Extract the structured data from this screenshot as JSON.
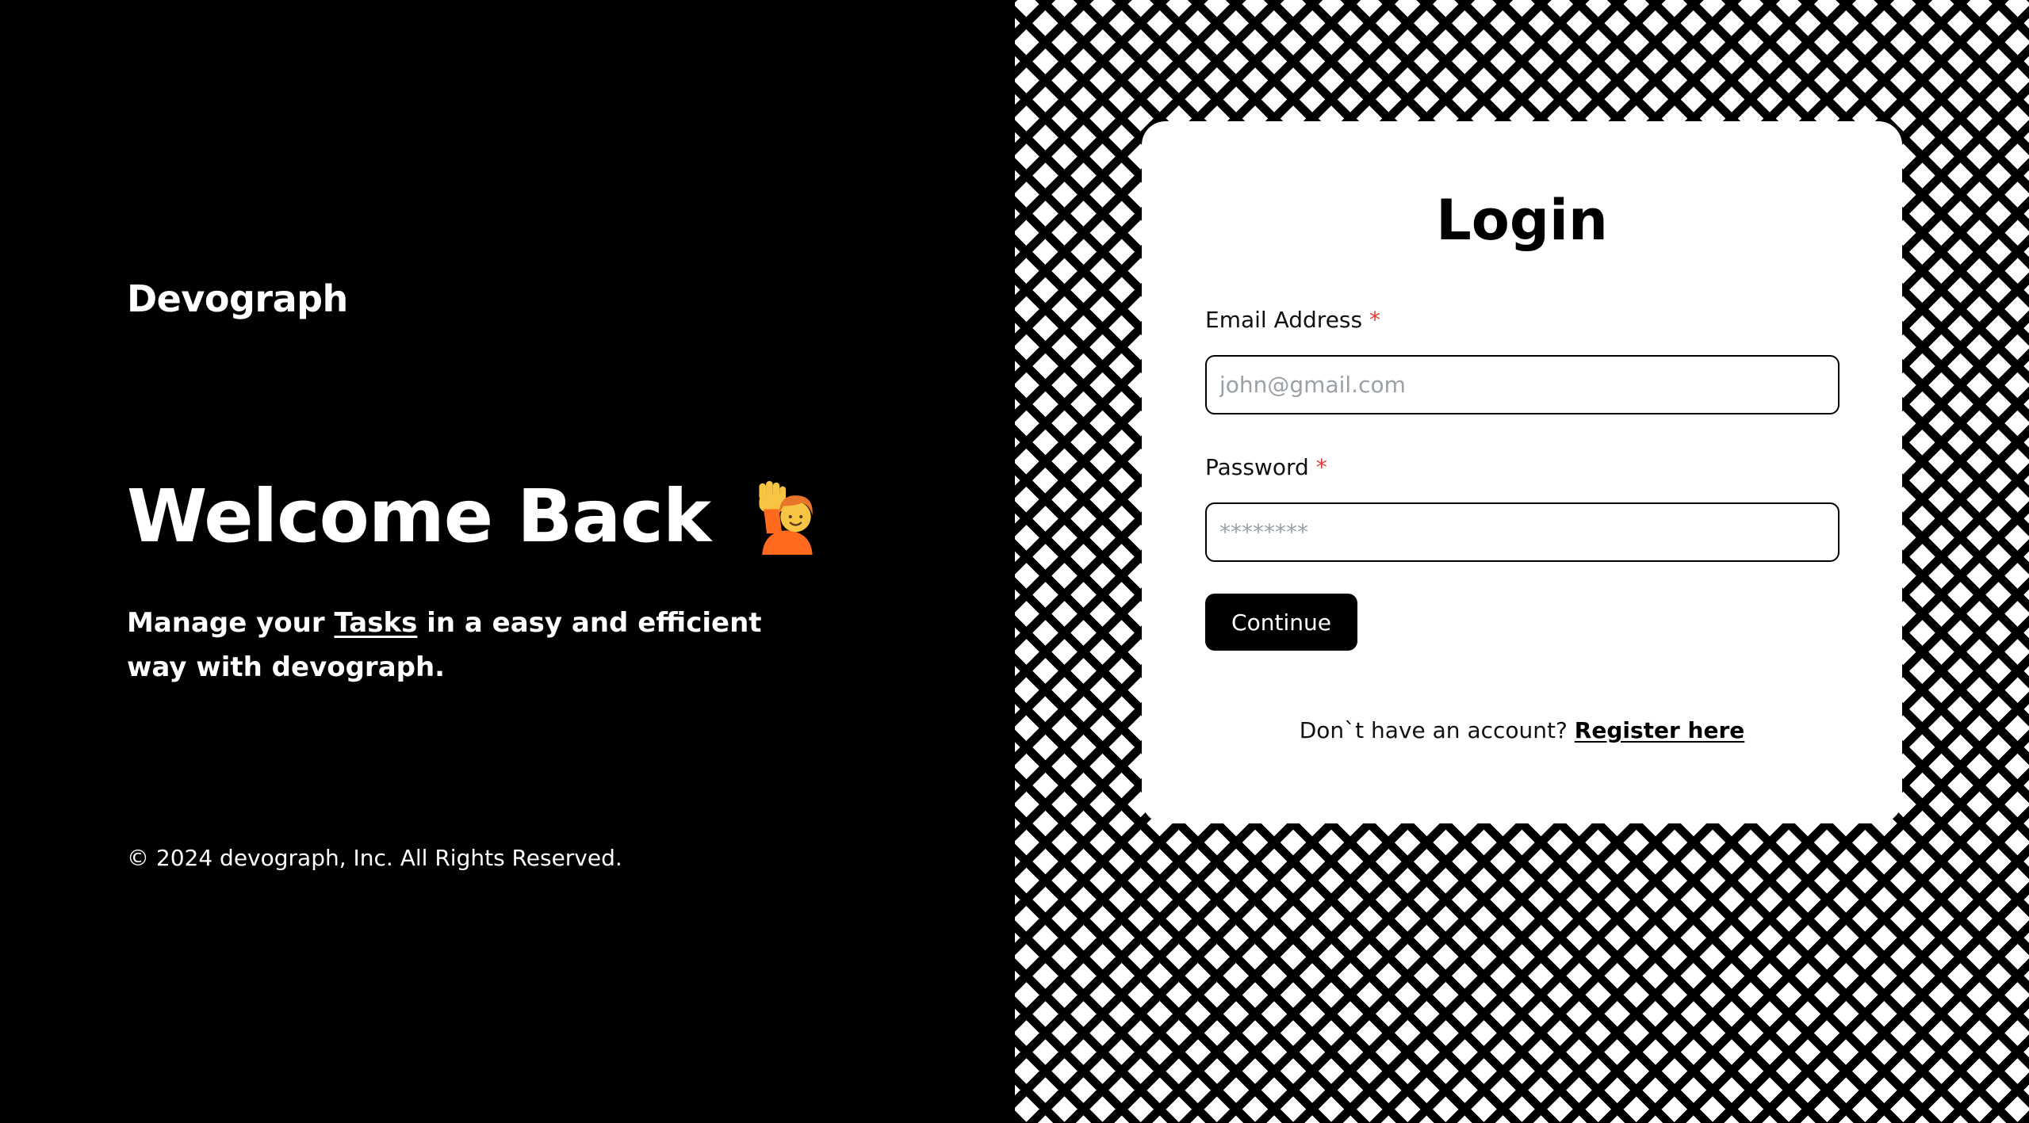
{
  "left_panel": {
    "brand": "Devograph",
    "headline": "Welcome Back",
    "headline_icon": "person-raising-hand-icon",
    "tagline_prefix": "Manage your ",
    "tagline_link": "Tasks",
    "tagline_suffix": " in a easy and efficient way with devograph.",
    "footer": "© 2024 devograph, Inc. All Rights Reserved."
  },
  "login_card": {
    "title": "Login",
    "email_label": "Email Address",
    "email_required_mark": "*",
    "email_placeholder": "john@gmail.com",
    "password_label": "Password",
    "password_required_mark": "*",
    "password_placeholder": "********",
    "continue_label": "Continue",
    "register_prompt": "Don`t have an account?",
    "register_link": "Register here"
  },
  "colors": {
    "background_left": "#000000",
    "card_background": "#ffffff",
    "required_mark": "#e53935",
    "button_background": "#000000"
  }
}
